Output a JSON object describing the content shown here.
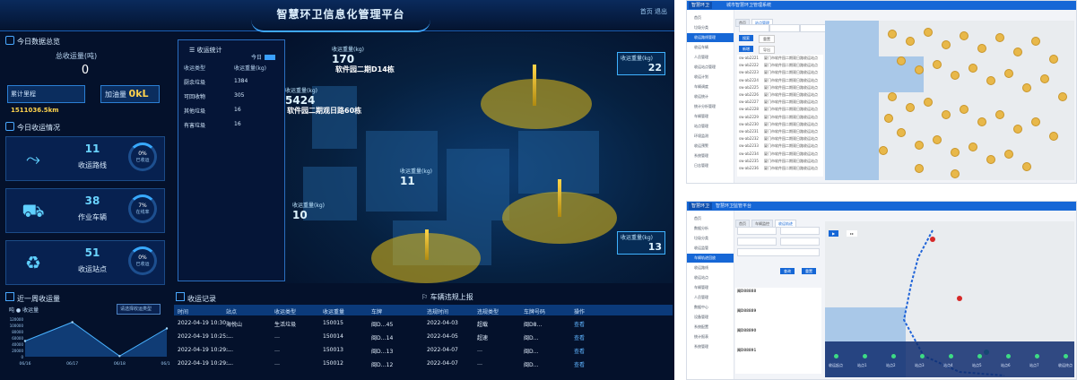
{
  "dashboard": {
    "title": "智慧环卫信息化管理平台",
    "top_right": "首页  退出",
    "summary": {
      "section_title": "今日数据总览",
      "label": "总收运量(吨)",
      "value": "0",
      "mileage_label": "累计里程",
      "mileage_value": "1511036.5km",
      "fuel_label": "加油量",
      "fuel_value": "0kL"
    },
    "today_section_title": "今日收运情况",
    "cards": [
      {
        "icon": "route-icon",
        "num": "11",
        "label": "收运路线",
        "pct": "0%",
        "pct_label": "已收运"
      },
      {
        "icon": "truck-icon",
        "num": "38",
        "label": "作业车辆",
        "pct": "7%",
        "pct_label": "在线率"
      },
      {
        "icon": "recycle-icon",
        "num": "51",
        "label": "收运站点",
        "pct": "0%",
        "pct_label": "已收运"
      }
    ],
    "stats_panel": {
      "title": "收运统计",
      "today": "今日",
      "headers": [
        "收运类型",
        "收运重量(kg)"
      ],
      "rows": [
        {
          "type": "厨余垃圾",
          "value": "1384"
        },
        {
          "type": "可回收物",
          "value": "305"
        },
        {
          "type": "其他垃圾",
          "value": "16"
        },
        {
          "type": "有害垃圾",
          "value": "16"
        }
      ]
    },
    "city": {
      "labels": [
        {
          "title": "收运重量(kg)",
          "num": "170",
          "caption": "软件园二期D14栋"
        },
        {
          "title": "收运重量(kg)",
          "num": "5424",
          "caption": "软件园二期观日路60栋"
        },
        {
          "title": "收运重量(kg)",
          "num": "10",
          "caption": ""
        },
        {
          "title": "收运重量(kg)",
          "num": "11",
          "caption": ""
        }
      ],
      "right_boxes": [
        {
          "title": "收运重量(kg)",
          "num": "22"
        },
        {
          "title": "收运重量(kg)",
          "num": "13"
        }
      ]
    },
    "chart": {
      "title": "近一周收运量",
      "legend_label": "收运量",
      "legend_unit": "吨",
      "btn": "请选择收运类型"
    },
    "chart_data": {
      "type": "area",
      "x": [
        "06/16",
        "06/17",
        "06/18",
        "06/19"
      ],
      "values": [
        50000,
        110000,
        2000,
        90000
      ],
      "yticks": [
        "120000",
        "100000",
        "80000",
        "60000",
        "40000",
        "20000",
        "0"
      ],
      "ylim": [
        0,
        120000
      ]
    },
    "records": {
      "title": "收运记录",
      "title2": "车辆违规上报",
      "headers": [
        "时间",
        "站点",
        "收运类型",
        "收运重量",
        "车牌",
        "违规时间",
        "违规类型",
        "车牌号码",
        "操作"
      ],
      "rows": [
        {
          "time": "2022-04-19 10:30:…",
          "station": "海悦山",
          "type": "生活垃圾",
          "weight": "150015",
          "plate": "闽D…45",
          "vtime": "2022-04-03",
          "vtype": "超载",
          "vplate": "闽D8…",
          "op": "查看"
        },
        {
          "time": "2022-04-19 10:25:…",
          "station": "…",
          "type": "…",
          "weight": "150014",
          "plate": "闽D…14",
          "vtime": "2022-04-05",
          "vtype": "超速",
          "vplate": "闽D…",
          "op": "查看"
        },
        {
          "time": "2022-04-19 10:29:…",
          "station": "…",
          "type": "…",
          "weight": "150013",
          "plate": "闽D…13",
          "vtime": "2022-04-07",
          "vtype": "…",
          "vplate": "闽D…",
          "op": "查看"
        },
        {
          "time": "2022-04-19 10:29:…",
          "station": "…",
          "type": "…",
          "weight": "150012",
          "plate": "闽D…12",
          "vtime": "2022-04-07",
          "vtype": "…",
          "vplate": "闽D…",
          "op": "查看"
        }
      ]
    }
  },
  "shot1": {
    "logo": "智慧环卫",
    "title": "城市智慧环卫管理系统",
    "sidebar": [
      "首页",
      "垃圾分类",
      "收运路线管理",
      "收运车辆",
      "人员管理",
      "收运站点管理",
      "收运计划",
      "车辆调度",
      "收运统计",
      "统计分析管理",
      "车辆管理",
      "站点管理",
      "环境监测",
      "收运预警",
      "系统管理",
      "日志管理"
    ],
    "tabs": [
      "首页",
      "站点管理"
    ],
    "btns": [
      "搜索",
      "重置",
      "新增",
      "导出"
    ],
    "rows": [
      "sw-ab2221",
      "sw-ab2222",
      "sw-ab2223",
      "sw-ab2224",
      "sw-ab2225",
      "sw-ab2226",
      "sw-ab2227",
      "sw-ab2228",
      "sw-ab2229",
      "sw-ab2230",
      "sw-ab2231",
      "sw-ab2232",
      "sw-ab2233",
      "sw-ab2234",
      "sw-ab2235",
      "sw-ab2236"
    ],
    "row_text": "厦门市软件园二期观日路收运站点"
  },
  "shot2": {
    "logo": "智慧环卫",
    "title": "智慧环卫监管平台",
    "sidebar": [
      "首页",
      "数据分析",
      "垃圾分类",
      "收运监管",
      "车辆轨迹回放",
      "收运路线",
      "收运站点",
      "车辆管理",
      "人员管理",
      "数据中心",
      "设备管理",
      "系统配置",
      "统计报表",
      "系统管理"
    ],
    "tabs": [
      "首页",
      "车辆监控",
      "收运轨迹"
    ],
    "search": "查询",
    "reset": "重置",
    "list_items": [
      "闽D88888",
      "闽D88889",
      "闽D88890",
      "闽D88891"
    ],
    "timeline": [
      "收运起点",
      "站点1",
      "站点2",
      "站点3",
      "站点4",
      "站点5",
      "站点6",
      "站点7",
      "收运终点"
    ]
  }
}
